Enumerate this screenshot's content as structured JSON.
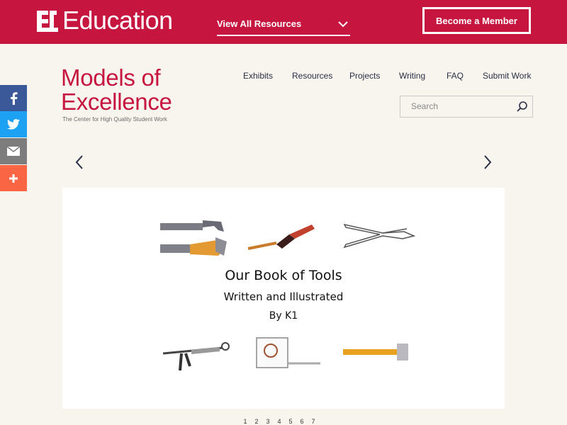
{
  "topbar": {
    "brand": "Education",
    "resources_label": "View All Resources",
    "member_button": "Become a Member"
  },
  "header": {
    "title_line1": "Models of",
    "title_line2": "Excellence",
    "subtitle": "The Center for High Quality Student Work",
    "nav": [
      "Exhibits",
      "Resources",
      "Projects",
      "Writing",
      "FAQ",
      "Submit Work"
    ],
    "search_placeholder": "Search"
  },
  "share": {
    "icons": [
      "facebook-icon",
      "twitter-icon",
      "email-icon",
      "plus-icon"
    ],
    "colors": [
      "#3b5998",
      "#1da1f2",
      "#7d7d7d",
      "#fa6644"
    ]
  },
  "slide": {
    "title_line1": "Our Book of Tools",
    "title_line2": "Written and Illustrated",
    "title_line3": "By K1"
  },
  "pager": [
    "1",
    "2",
    "3",
    "4",
    "5",
    "6",
    "7"
  ],
  "colors": {
    "brand": "#c6153f",
    "background": "#f7f5ee",
    "nav_text": "#2a2f45"
  }
}
